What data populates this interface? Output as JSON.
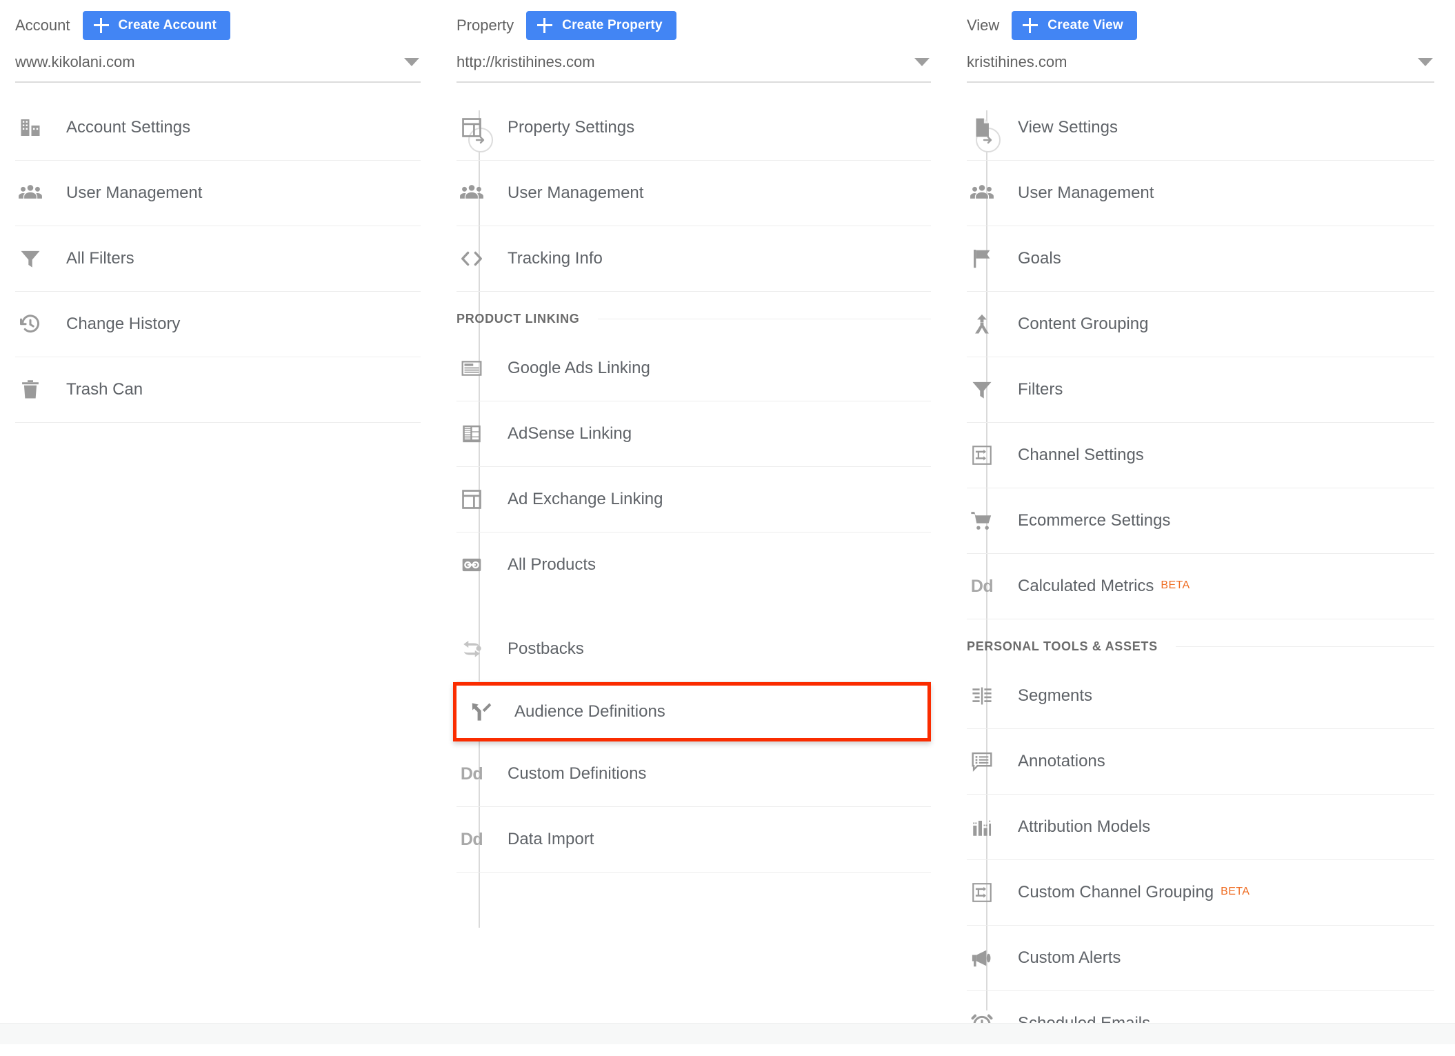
{
  "columns": {
    "account": {
      "label": "Account",
      "create_button": "Create Account",
      "selected": "www.kikolani.com",
      "items": [
        {
          "label": "Account Settings",
          "icon": "building-icon"
        },
        {
          "label": "User Management",
          "icon": "people-icon"
        },
        {
          "label": "All Filters",
          "icon": "funnel-icon"
        },
        {
          "label": "Change History",
          "icon": "history-icon"
        },
        {
          "label": "Trash Can",
          "icon": "trash-icon"
        }
      ]
    },
    "property": {
      "label": "Property",
      "create_button": "Create Property",
      "selected": "http://kristihines.com",
      "items": [
        {
          "label": "Property Settings",
          "icon": "layout-icon"
        },
        {
          "label": "User Management",
          "icon": "people-icon"
        },
        {
          "label": "Tracking Info",
          "icon": "code-brackets-icon"
        }
      ],
      "section_title": "PRODUCT LINKING",
      "linking_items": [
        {
          "label": "Google Ads Linking",
          "icon": "ad-banner-icon"
        },
        {
          "label": "AdSense Linking",
          "icon": "adsense-grid-icon"
        },
        {
          "label": "Ad Exchange Linking",
          "icon": "layout-icon"
        },
        {
          "label": "All Products",
          "icon": "link-chain-icon"
        }
      ],
      "tail_items": [
        {
          "label": "Postbacks",
          "icon": "postback-arrows-icon",
          "highlighted": false
        },
        {
          "label": "Audience Definitions",
          "icon": "audience-branch-icon",
          "highlighted": true
        },
        {
          "label": "Custom Definitions",
          "icon": "dd-icon",
          "highlighted": false
        },
        {
          "label": "Data Import",
          "icon": "dd-icon",
          "highlighted": false
        }
      ]
    },
    "view": {
      "label": "View",
      "create_button": "Create View",
      "selected": "kristihines.com",
      "items": [
        {
          "label": "View Settings",
          "icon": "document-icon",
          "beta": ""
        },
        {
          "label": "User Management",
          "icon": "people-icon",
          "beta": ""
        },
        {
          "label": "Goals",
          "icon": "flag-icon",
          "beta": ""
        },
        {
          "label": "Content Grouping",
          "icon": "merge-arrows-icon",
          "beta": ""
        },
        {
          "label": "Filters",
          "icon": "funnel-icon",
          "beta": ""
        },
        {
          "label": "Channel Settings",
          "icon": "channel-box-icon",
          "beta": ""
        },
        {
          "label": "Ecommerce Settings",
          "icon": "shopping-cart-icon",
          "beta": ""
        },
        {
          "label": "Calculated Metrics",
          "icon": "dd-icon",
          "beta": "BETA"
        }
      ],
      "section_title": "PERSONAL TOOLS & ASSETS",
      "tools_items": [
        {
          "label": "Segments",
          "icon": "segments-icon",
          "beta": ""
        },
        {
          "label": "Annotations",
          "icon": "comment-list-icon",
          "beta": ""
        },
        {
          "label": "Attribution Models",
          "icon": "bar-chart-icon",
          "beta": ""
        },
        {
          "label": "Custom Channel Grouping",
          "icon": "channel-box-icon",
          "beta": "BETA"
        },
        {
          "label": "Custom Alerts",
          "icon": "megaphone-icon",
          "beta": ""
        },
        {
          "label": "Scheduled Emails",
          "icon": "alarm-clock-icon",
          "beta": ""
        }
      ]
    }
  },
  "colors": {
    "accent_blue": "#4285f4",
    "beta_orange": "#ef6c22",
    "highlight_red": "#fa2c00",
    "text_gray": "#5f6368",
    "icon_gray": "#9a9a9a"
  }
}
